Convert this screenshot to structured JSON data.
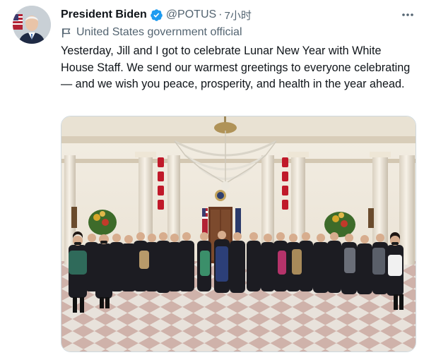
{
  "user": {
    "display_name": "President Biden",
    "handle": "@POTUS",
    "separator": "·",
    "timestamp": "7小时",
    "account_label": "United States government official"
  },
  "tweet": {
    "text": "Yesterday, Jill and I got to celebrate Lunar New Year with White House Staff. We send our warmest greetings to everyone celebrating — and we wish you peace, prosperity, and health in the year ahead."
  },
  "icons": {
    "verified": "verified-badge-icon",
    "government": "flag-icon",
    "more": "more-options-icon"
  },
  "colors": {
    "verified_blue": "#1d9bf0",
    "secondary_text": "#536471",
    "primary_text": "#0f1419"
  }
}
